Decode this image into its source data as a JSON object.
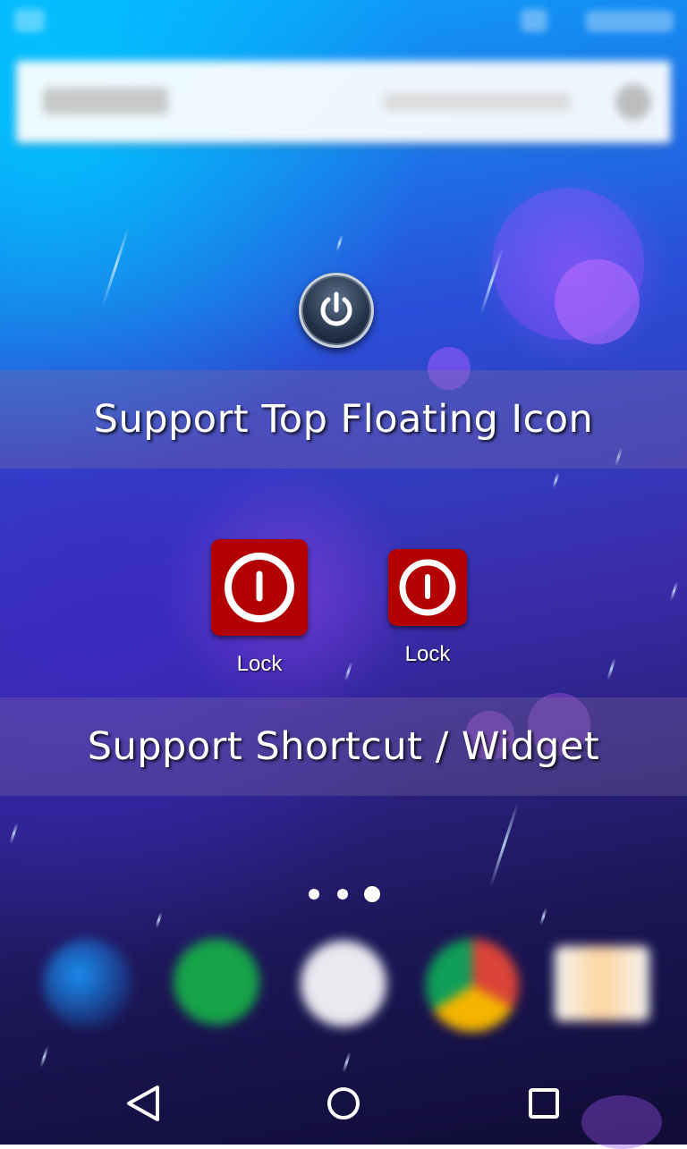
{
  "banners": {
    "top": "Support Top Floating Icon",
    "bottom": "Support Shortcut / Widget"
  },
  "shortcuts": [
    {
      "label": "Lock",
      "icon": "power-icon"
    },
    {
      "label": "Lock",
      "icon": "power-icon"
    }
  ],
  "floating_icon": "power-icon",
  "page_indicator": {
    "count": 3,
    "active_index": 2
  },
  "navigation": [
    "back",
    "home",
    "recents"
  ],
  "colors": {
    "lock_red": "#b30000",
    "banner_overlay": "rgba(130,110,160,0.32)"
  }
}
